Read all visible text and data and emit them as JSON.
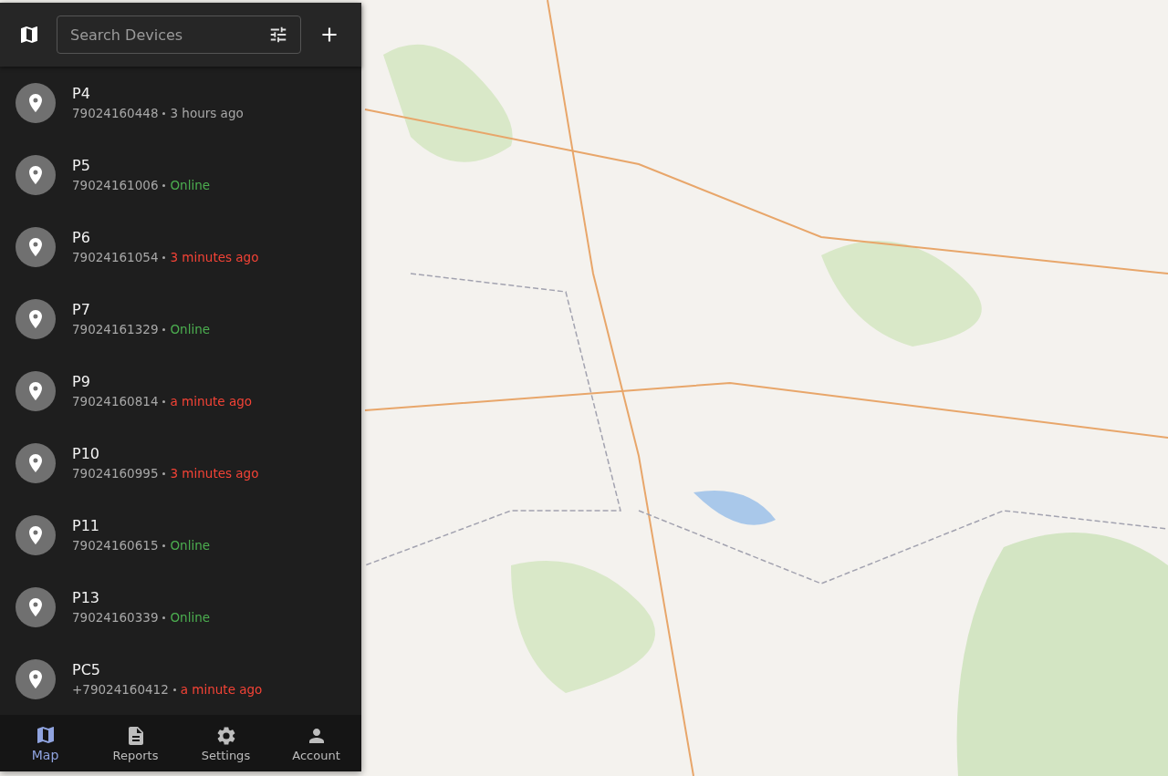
{
  "header": {
    "search": {
      "placeholder": "Search Devices"
    }
  },
  "devices": [
    {
      "name": "P4",
      "identifier": "79024160448",
      "kind": "offline",
      "last_seen": "3 hours ago"
    },
    {
      "name": "P5",
      "identifier": "79024161006",
      "kind": "online",
      "last_seen": "Online"
    },
    {
      "name": "P6",
      "identifier": "79024161054",
      "kind": "unknown",
      "last_seen": "3 minutes ago"
    },
    {
      "name": "P7",
      "identifier": "79024161329",
      "kind": "online",
      "last_seen": "Online"
    },
    {
      "name": "P9",
      "identifier": "79024160814",
      "kind": "unknown",
      "last_seen": "a minute ago"
    },
    {
      "name": "P10",
      "identifier": "79024160995",
      "kind": "unknown",
      "last_seen": "3 minutes ago"
    },
    {
      "name": "P11",
      "identifier": "79024160615",
      "kind": "online",
      "last_seen": "Online"
    },
    {
      "name": "P13",
      "identifier": "79024160339",
      "kind": "online",
      "last_seen": "Online"
    },
    {
      "name": "PC5",
      "identifier": "+79024160412",
      "kind": "unknown",
      "last_seen": "a minute ago"
    }
  ],
  "bottom_nav": [
    {
      "label": "Map",
      "kind": "map",
      "selected": true
    },
    {
      "label": "Reports",
      "kind": "reports",
      "selected": false
    },
    {
      "label": "Settings",
      "kind": "settings",
      "selected": false
    },
    {
      "label": "Account",
      "kind": "account",
      "selected": false
    }
  ]
}
